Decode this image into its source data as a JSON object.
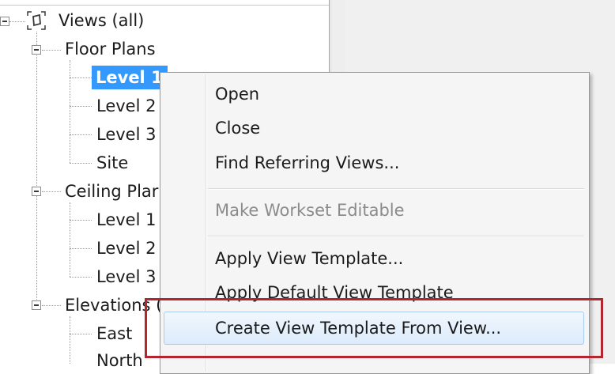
{
  "tree": {
    "root_label": "Views (all)",
    "groups": [
      {
        "label": "Floor Plans",
        "children": [
          "Level 1",
          "Level 2",
          "Level 3",
          "Site"
        ],
        "selected_index": 0
      },
      {
        "label": "Ceiling Plar",
        "children": [
          "Level 1",
          "Level 2",
          "Level 3"
        ]
      },
      {
        "label": "Elevations (",
        "children": [
          "East",
          "North"
        ]
      }
    ]
  },
  "context_menu": {
    "items": [
      {
        "label": "Open",
        "enabled": true
      },
      {
        "label": "Close",
        "enabled": true
      },
      {
        "label": "Find Referring Views...",
        "enabled": true
      },
      {
        "label": "Make Workset Editable",
        "enabled": false
      },
      {
        "label": "Apply View Template...",
        "enabled": true
      },
      {
        "label": "Apply Default View Template",
        "enabled": true
      },
      {
        "label": "Create View Template From View...",
        "enabled": true,
        "hovered": true
      }
    ]
  },
  "colors": {
    "selection": "#3399ff",
    "highlight_box": "#b22630",
    "disabled_text": "#8b8b8b"
  },
  "icons": {
    "views_root": "views-icon",
    "expander": "collapse-minus-icon"
  }
}
